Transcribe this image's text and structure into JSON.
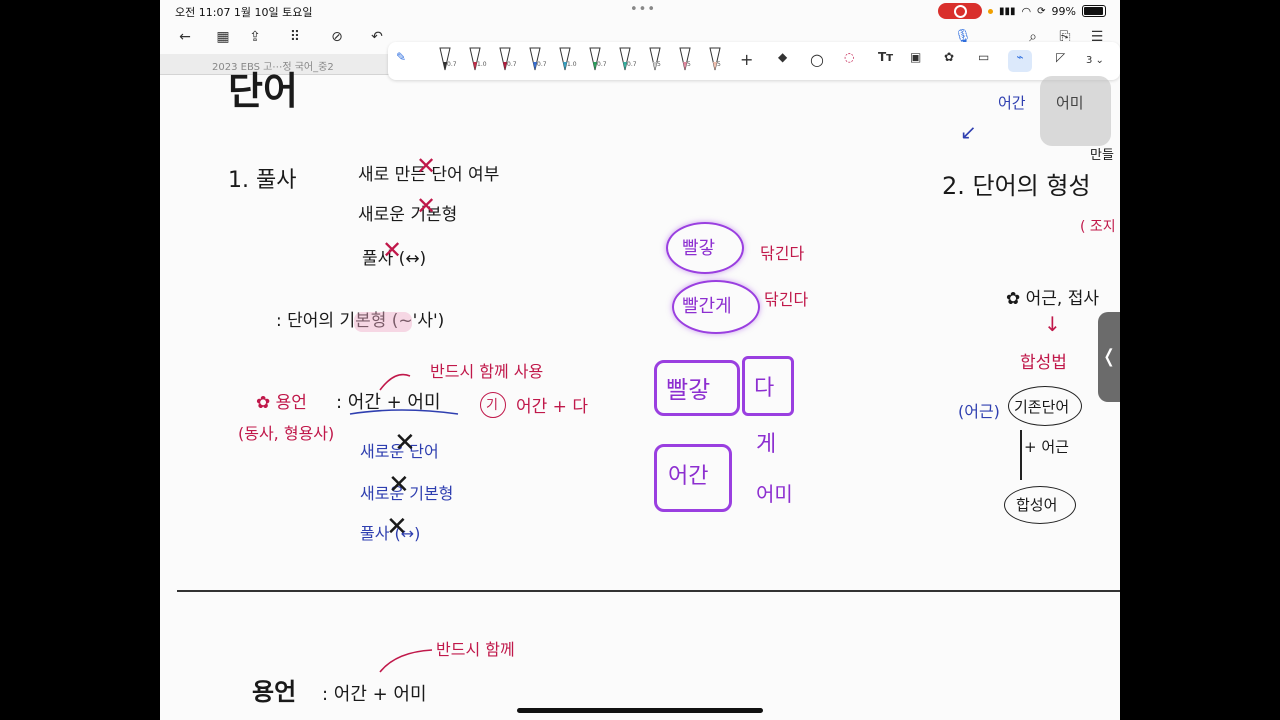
{
  "status": {
    "time_date": "오전 11:07   1월 10일 토요일",
    "battery_pct": "99%"
  },
  "document": {
    "tab_title": "2023 EBS 고⋯정 국어_중2",
    "page_label": "3"
  },
  "toolbar": {
    "pen_sizes": [
      "0.7",
      "1.0",
      "0.7",
      "0.7",
      "1.0",
      "0.7",
      "0.7",
      "5",
      "5",
      "5"
    ],
    "pen_colors": [
      "#333333",
      "#c0304a",
      "#b02040",
      "#3a6fd0",
      "#3aa0c0",
      "#2fa060",
      "#3ab0a0",
      "#cccccc",
      "#e08aa0",
      "#f0c0b0"
    ]
  },
  "notes": {
    "heading_partial": "단어",
    "section1": "1. 풀사",
    "s1_line1": "새로 만든 단어 여부",
    "s1_line2": "새로운 기본형",
    "s1_line3": "풀사 (↔)",
    "def_line": ": 단어의 기본형 (~'사')",
    "yongeon_label": "✿ 용언",
    "yongeon_sub": "(동사, 형용사)",
    "formula": ": 어간 + 어미",
    "annot_together": "반드시 함께 사용",
    "ex_circle": "기",
    "ex_formula": "어간 + 다",
    "blue1": "새로운 단어",
    "blue2": "새로운 기본형",
    "blue3": "풀사 (↔)",
    "pur_w1": "빨갛",
    "pur_w2": "빨간게",
    "red_w1": "닦긴다",
    "red_w2": "닦긴다",
    "pur_b1": "빨갛",
    "pur_b2": "다",
    "pur_b3": "어간",
    "pur_b4": "게",
    "pur_b5": "어미",
    "section2": "2. 단어의 형성",
    "s2_sub": "( 조지",
    "s2_star": "✿ 어근, 접사",
    "s2_arrow": "↓",
    "s2_hapsung": "합성법",
    "s2_eogeun": "(어근)",
    "s2_existing": "기존단어",
    "s2_plus": "+ 어근",
    "s2_result": "합성어",
    "top_blue": "어간",
    "top_gray": "어미",
    "right_cut": "만들",
    "bottom_label": "용언",
    "bottom_formula": ": 어간 + 어미",
    "bottom_annot": "반드시 함께"
  }
}
